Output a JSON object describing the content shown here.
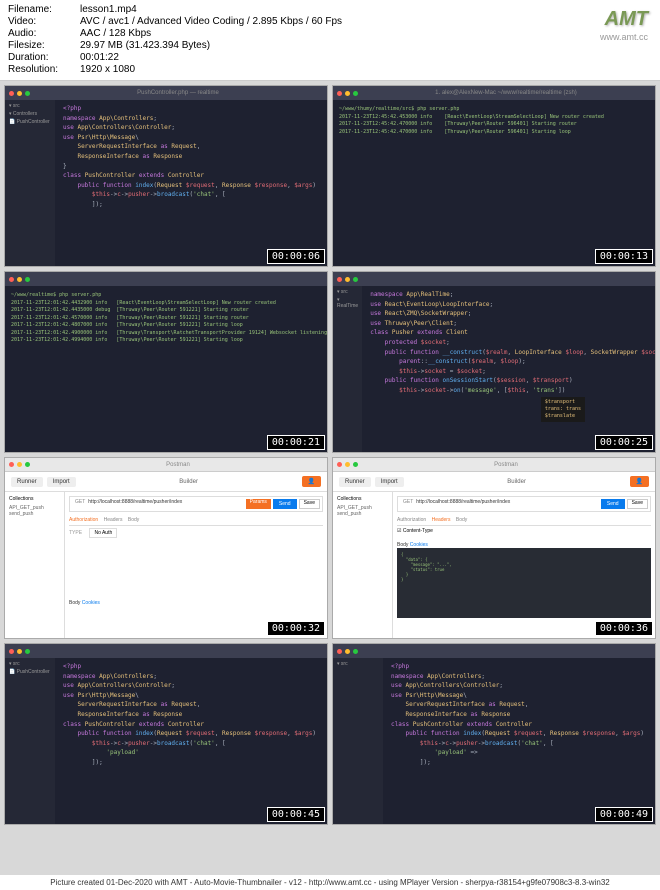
{
  "meta": {
    "filename_label": "Filename:",
    "filename": "lesson1.mp4",
    "video_label": "Video:",
    "video": "AVC / avc1 / Advanced Video Coding / 2.895 Kbps / 60 Fps",
    "audio_label": "Audio:",
    "audio": "AAC / 128 Kbps",
    "filesize_label": "Filesize:",
    "filesize": "29.97 MB (31.423.394 Bytes)",
    "duration_label": "Duration:",
    "duration": "00:01:22",
    "resolution_label": "Resolution:",
    "resolution": "1920 x 1080"
  },
  "logo": "AMT",
  "logo_url": "www.amt.cc",
  "thumbs": [
    {
      "ts": "00:00:06",
      "type": "code1"
    },
    {
      "ts": "00:00:13",
      "type": "term"
    },
    {
      "ts": "00:00:21",
      "type": "term2"
    },
    {
      "ts": "00:00:25",
      "type": "code2"
    },
    {
      "ts": "00:00:32",
      "type": "postman1"
    },
    {
      "ts": "00:00:36",
      "type": "postman2"
    },
    {
      "ts": "00:00:45",
      "type": "code3"
    },
    {
      "ts": "00:00:49",
      "type": "code4"
    }
  ],
  "code1": {
    "l1": "<?php",
    "l2": "namespace App\\Controllers;",
    "l3": "use App\\Controllers\\Controller;",
    "l4": "use Psr\\Http\\Message\\",
    "l5": "    ServerRequestInterface as Request,",
    "l6": "    ResponseInterface as Response",
    "l7": "}",
    "l8": "class PushController extends Controller",
    "l9": "    public function index(Request $request, Response $response, $args)",
    "l10": "        $this->c->pusher->broadcast('chat', [",
    "l11": "        ]);"
  },
  "term1": {
    "l1": "~/www/thumy/realtime/src$ php server.php",
    "l2": "2017-11-23T12:45:42.453000 info    [React\\EventLoop\\StreamSelectLoop] New router created",
    "l3": "2017-11-23T12:45:42.470000 info    [Thruway\\Peer\\Router 596401] Starting router",
    "l4": "2017-11-23T12:45:42.470000 info    [Thruway\\Peer\\Router 596401] Starting loop"
  },
  "term2": {
    "l1": "~/www/realtime$ php server.php",
    "l2": "2017-11-23T12:01:42.4432900 info   [React\\EventLoop\\StreamSelectLoop] New router created",
    "l3": "2017-11-23T12:01:42.4435000 debug  [Thruway\\Peer\\Router 591221] Starting router",
    "l4": "2017-11-23T12:01:42.4570000 info   [Thruway\\Peer\\Router 591221] Starting router",
    "l5": "2017-11-23T12:01:42.4807000 info   [Thruway\\Peer\\Router 591221] Starting loop",
    "l6": "2017-11-23T12:01:42.4900000 info   [Thruway\\Transport\\RatchetTransportProvider 19124] Websocket listening on 0.0.0.0:9090",
    "l7": "2017-11-23T12:01:42.4994000 info   [Thruway\\Peer\\Router 591221] Starting loop"
  },
  "code2": {
    "l1": "namespace App\\RealTime;",
    "l2": "use React\\EventLoop\\LoopInterface;",
    "l3": "use React\\ZMQ\\SocketWrapper;",
    "l4": "use Thruway\\Peer\\Client;",
    "l5": "class Pusher extends Client",
    "l6": "    protected $socket;",
    "l7": "    public function __construct($realm, LoopInterface $loop, SocketWrapper $socket)",
    "l8": "        parent::__construct($realm, $loop);",
    "l9": "        $this->socket = $socket;",
    "l10": "    public function onSessionStart($session, $transport)",
    "l11": "        $this->socket->on('message', [$this, 'trans'])",
    "tooltip1": "$transport",
    "tooltip2": "trans: trans",
    "tooltip3": "$translate"
  },
  "code3": {
    "l10": "        $this->c->pusher->broadcast('chat', [",
    "l11": "            'payload'",
    "l12": "        ]);"
  },
  "postman": {
    "builder": "Builder",
    "import": "Import",
    "runner": "Runner",
    "collections": "Collections",
    "get": "GET",
    "url": "http://localhost:8888/realtime/pusher/index",
    "send": "Send",
    "save": "Save",
    "params": "Params",
    "auth": "Authorization",
    "headers": "Headers",
    "body": "Body",
    "type": "TYPE",
    "noauth": "No Auth",
    "contenttype": "Content-Type",
    "side1": "API_GET_push",
    "side2": "send_push",
    "cookies": "Cookies"
  },
  "footer": "Picture created 01-Dec-2020 with AMT - Auto-Movie-Thumbnailer - v12 - http://www.amt.cc - using MPlayer Version - sherpya-r38154+g9fe07908c3-8.3-win32"
}
